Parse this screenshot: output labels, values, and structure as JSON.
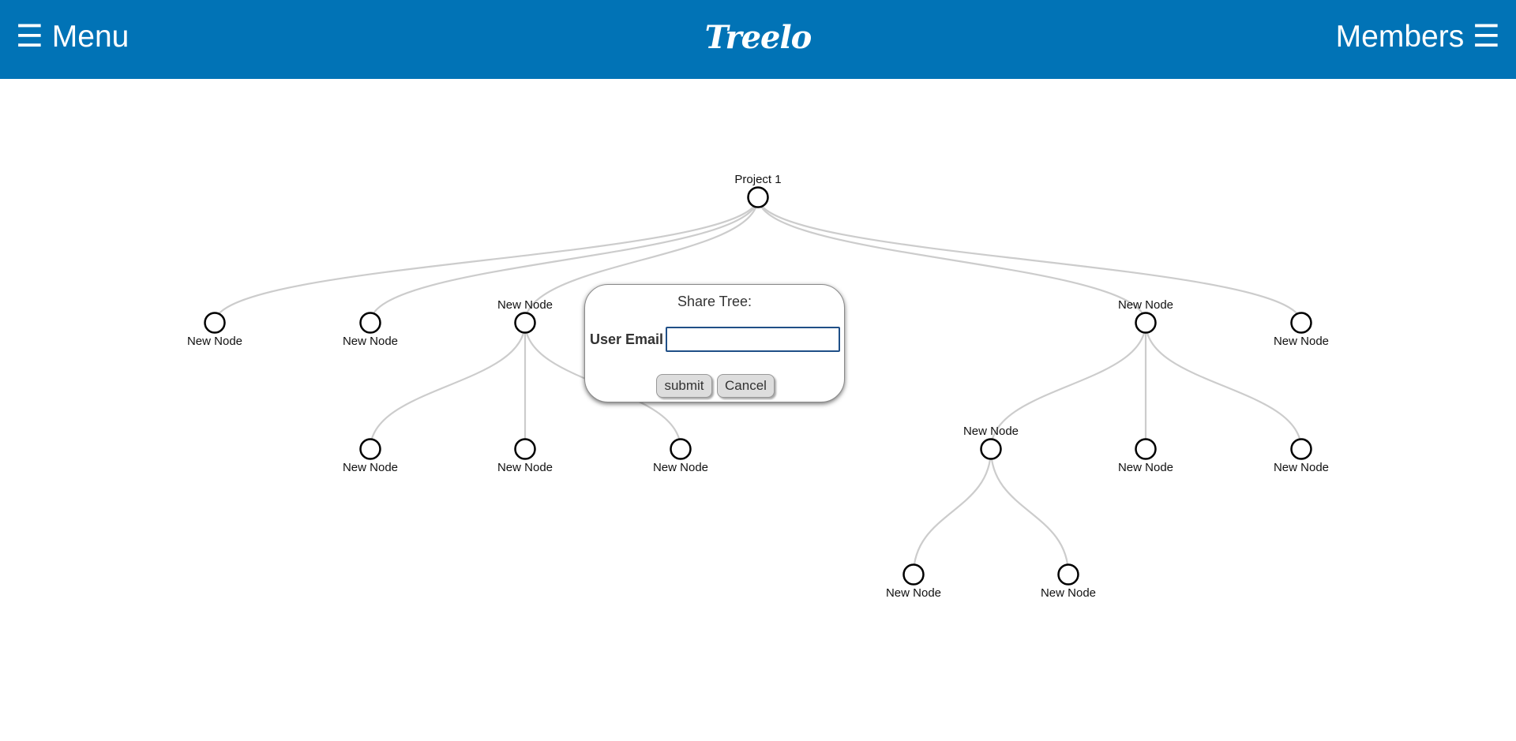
{
  "header": {
    "menu_label": "☰ Menu",
    "brand": "Treelo",
    "members_label": "Members ☰",
    "background_color": "#0173b6"
  },
  "tree": {
    "link_color": "#cccccc",
    "nodes": [
      {
        "id": "root",
        "label": "Project 1",
        "label_side": "above"
      },
      {
        "id": "n1",
        "parent": "root",
        "label": "New Node",
        "label_side": "below"
      },
      {
        "id": "n2",
        "parent": "root",
        "label": "New Node",
        "label_side": "below"
      },
      {
        "id": "n3",
        "parent": "root",
        "label": "New Node",
        "label_side": "above"
      },
      {
        "id": "n4",
        "parent": "root",
        "label": "New Node",
        "label_side": "above"
      },
      {
        "id": "n5",
        "parent": "root",
        "label": "New Node",
        "label_side": "below"
      },
      {
        "id": "n3a",
        "parent": "n3",
        "label": "New Node",
        "label_side": "below"
      },
      {
        "id": "n3b",
        "parent": "n3",
        "label": "New Node",
        "label_side": "below"
      },
      {
        "id": "n3c",
        "parent": "n3",
        "label": "New Node",
        "label_side": "below"
      },
      {
        "id": "n4a",
        "parent": "n4",
        "label": "New Node",
        "label_side": "above"
      },
      {
        "id": "n4b",
        "parent": "n4",
        "label": "New Node",
        "label_side": "below"
      },
      {
        "id": "n4c",
        "parent": "n4",
        "label": "New Node",
        "label_side": "below"
      },
      {
        "id": "n4a1",
        "parent": "n4a",
        "label": "New Node",
        "label_side": "below"
      },
      {
        "id": "n4a2",
        "parent": "n4a",
        "label": "New Node",
        "label_side": "below"
      }
    ]
  },
  "share_dialog": {
    "title": "Share Tree:",
    "email_label": "User Email",
    "email_value": "",
    "email_placeholder": "",
    "submit_label": "submit",
    "cancel_label": "Cancel"
  }
}
